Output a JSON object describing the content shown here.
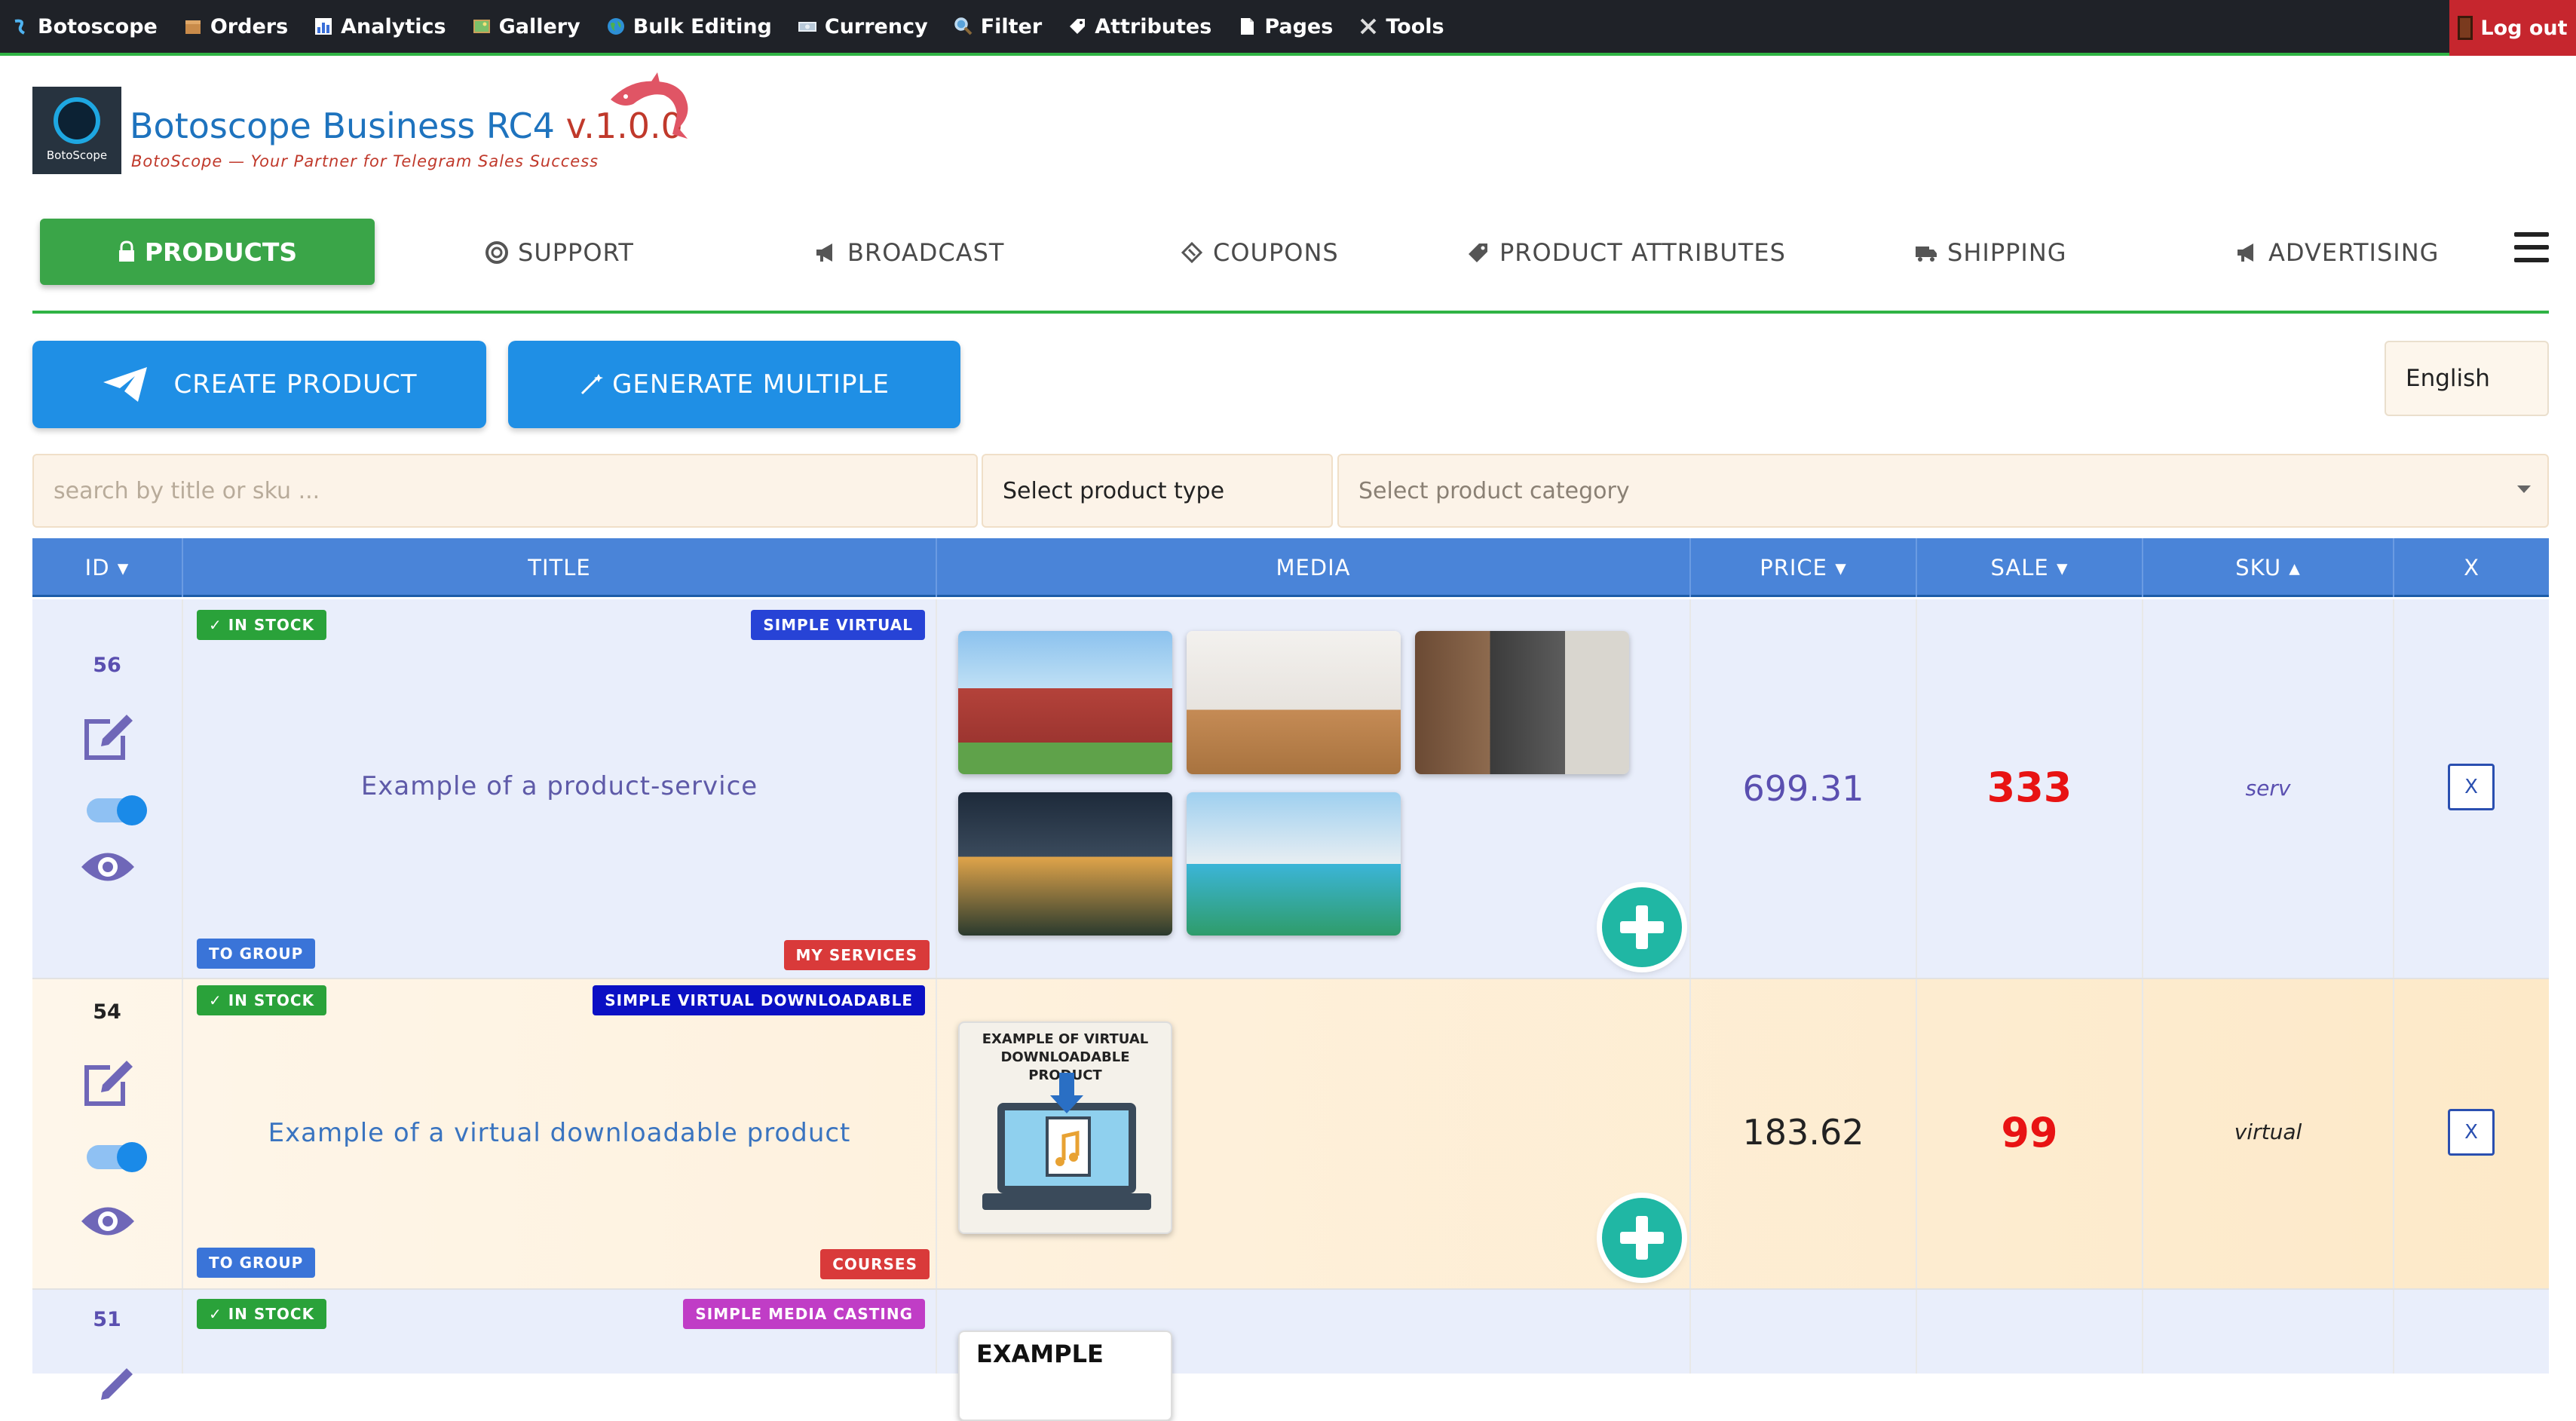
{
  "topbar": {
    "items": [
      {
        "label": "Botoscope",
        "icon": "bot-icon"
      },
      {
        "label": "Orders",
        "icon": "box-icon"
      },
      {
        "label": "Analytics",
        "icon": "chart-icon"
      },
      {
        "label": "Gallery",
        "icon": "picture-icon"
      },
      {
        "label": "Bulk Editing",
        "icon": "globe-icon"
      },
      {
        "label": "Currency",
        "icon": "banknote-icon"
      },
      {
        "label": "Filter",
        "icon": "magnifier-icon"
      },
      {
        "label": "Attributes",
        "icon": "tag-icon"
      },
      {
        "label": "Pages",
        "icon": "page-icon"
      },
      {
        "label": "Tools",
        "icon": "tools-icon"
      }
    ],
    "logout": "Log out"
  },
  "brand": {
    "logo_label": "BotoScope",
    "title": "Botoscope Business RC4",
    "version": "v.1.0.0",
    "subtitle": "BotoScope — Your Partner for Telegram Sales Success"
  },
  "nav": {
    "active": "PRODUCTS",
    "items": [
      "SUPPORT",
      "BROADCAST",
      "COUPONS",
      "PRODUCT ATTRIBUTES",
      "SHIPPING",
      "ADVERTISING"
    ]
  },
  "actions": {
    "create": "CREATE PRODUCT",
    "generate": "GENERATE MULTIPLE",
    "language": "English"
  },
  "filters": {
    "search_placeholder": "search by title or sku ...",
    "type": "Select product type",
    "category": "Select product category"
  },
  "table": {
    "headers": {
      "id": "ID ▾",
      "title": "TITLE",
      "media": "MEDIA",
      "price": "PRICE ▾",
      "sale": "SALE ▾",
      "sku": "SKU ▴",
      "x": "X"
    },
    "rows": [
      {
        "id": "56",
        "stock": "✓ IN STOCK",
        "type": "SIMPLE VIRTUAL",
        "title": "Example of a product-service",
        "group": "TO GROUP",
        "category": "MY SERVICES",
        "price": "699.31",
        "sale": "333",
        "sku": "serv",
        "delete": "X",
        "colors": {
          "bg": "#e9eefb",
          "type_badge": "#2743d6",
          "category_badge": "#d93a3a",
          "id": "#5a4fb0",
          "title": "#5e5aa8",
          "price": "#5a4fb0"
        }
      },
      {
        "id": "54",
        "stock": "✓ IN STOCK",
        "type": "SIMPLE VIRTUAL DOWNLOADABLE",
        "title": "Example of a virtual downloadable product",
        "group": "TO GROUP",
        "category": "COURSES",
        "price": "183.62",
        "sale": "99",
        "sku": "virtual",
        "delete": "X",
        "media_caption": "EXAMPLE OF VIRTUAL DOWNLOADABLE PRODUCT",
        "colors": {
          "bg": "#fdf0dc",
          "type_badge": "#0b10c4",
          "category_badge": "#d93a3a",
          "id": "#222222",
          "title": "#3a74c0",
          "price": "#222222"
        }
      },
      {
        "id": "51",
        "stock": "✓ IN STOCK",
        "type": "SIMPLE MEDIA CASTING",
        "media_caption": "EXAMPLE",
        "colors": {
          "bg": "#e9eefb",
          "type_badge": "#c03dc6",
          "id": "#5a4fb0"
        }
      }
    ]
  }
}
